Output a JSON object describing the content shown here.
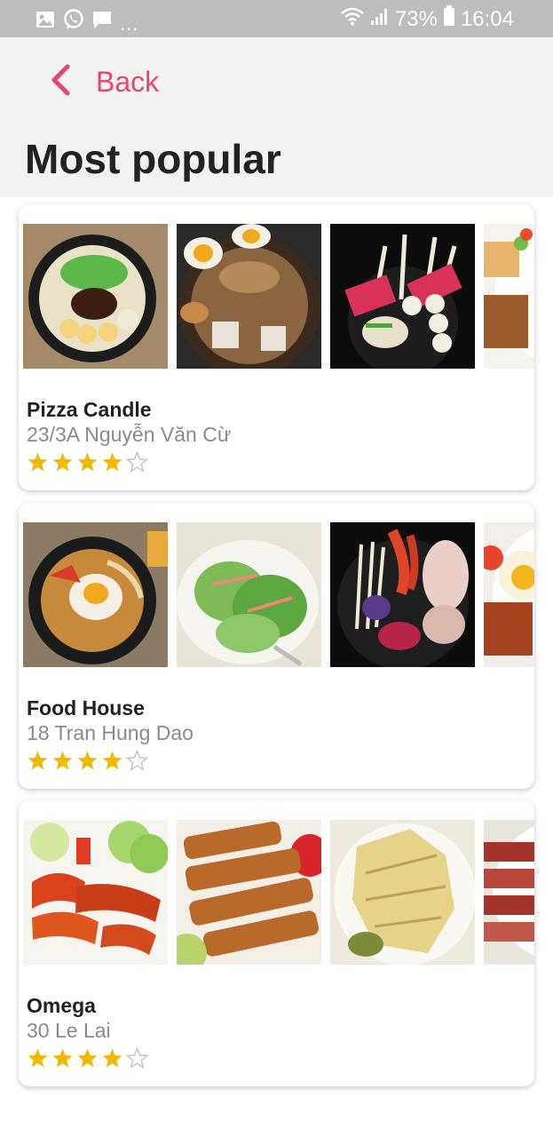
{
  "status_bar": {
    "battery_percent": "73%",
    "time": "16:04",
    "left_icons": [
      "image-icon",
      "viber-icon",
      "message-icon"
    ],
    "overflow": "...",
    "right_icons": [
      "wifi-icon",
      "signal-icon",
      "battery-icon"
    ]
  },
  "header": {
    "back_label": "Back",
    "title": "Most popular"
  },
  "colors": {
    "accent": "#e5486b",
    "header_bg": "#f2f2f2",
    "status_bar_bg": "#bdbdbd",
    "star_filled": "#f5b800",
    "address_text": "#8a8a8a"
  },
  "restaurants": [
    {
      "name": "Pizza Candle",
      "address": "23/3A Nguyễn Văn Cừ",
      "rating": 4,
      "max_rating": 5,
      "photos": [
        "noodle-bowl-photo",
        "ramen-egg-photo",
        "hotpot-mushroom-photo",
        "rice-plate-photo"
      ]
    },
    {
      "name": "Food House",
      "address": "18 Tran Hung Dao",
      "rating": 4,
      "max_rating": 5,
      "photos": [
        "bibimbap-egg-photo",
        "salad-photo",
        "seafood-hotpot-photo",
        "roast-pork-egg-photo"
      ]
    },
    {
      "name": "Omega",
      "address": "30 Le Lai",
      "rating": 4,
      "max_rating": 5,
      "photos": [
        "sausage-cucumber-photo",
        "fried-cutlet-photo",
        "boiled-chicken-photo",
        "char-siu-photo"
      ]
    }
  ]
}
